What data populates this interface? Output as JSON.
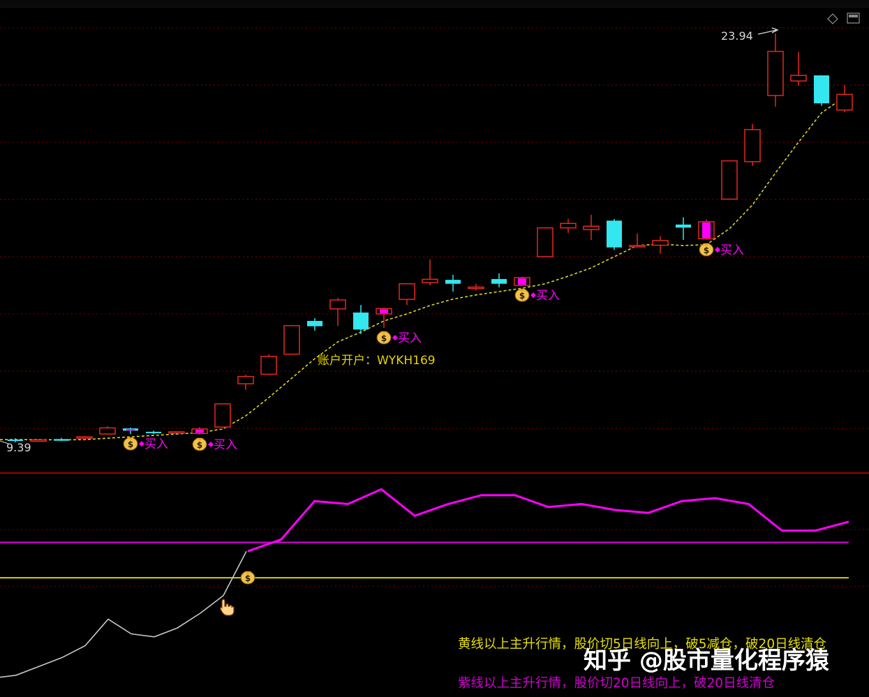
{
  "colors": {
    "up": "#e8271f",
    "down": "#33e6f0",
    "magenta": "#ff00ff",
    "ma_yellow": "#d9d42a",
    "yellow_text": "#e6e000",
    "grid": "#8a0000",
    "white_line": "#c8c8c8"
  },
  "icons": {
    "buy_marker": "money-bag-icon",
    "cursor": "hand-pointer-icon",
    "diamond": "diamond-icon",
    "window": "window-icon"
  },
  "price_panel": {
    "high_label": "23.94",
    "low_label": "9.39",
    "account_text": "账户开户：WYKH169"
  },
  "buy_label": "买入",
  "indicator_panel": {
    "legend_yellow": "黄线以上主升行情，股价切5日线向上，破5减仓，破20日线清仓",
    "legend_purple": "紫线以上主升行情，股价切20日线向上，破20日线清仓"
  },
  "watermark": "知乎 @股市量化程序猿",
  "chart_data": [
    {
      "type": "candlestick",
      "title": "",
      "ylim": [
        9.0,
        25.0
      ],
      "candles": [
        {
          "o": 9.4,
          "h": 9.45,
          "l": 9.3,
          "c": 9.35
        },
        {
          "o": 9.38,
          "h": 9.42,
          "l": 9.33,
          "c": 9.39
        },
        {
          "o": 9.42,
          "h": 9.46,
          "l": 9.35,
          "c": 9.36
        },
        {
          "o": 9.45,
          "h": 9.52,
          "l": 9.4,
          "c": 9.5
        },
        {
          "o": 9.6,
          "h": 9.88,
          "l": 9.58,
          "c": 9.82
        },
        {
          "o": 9.8,
          "h": 9.83,
          "l": 9.6,
          "c": 9.72
        },
        {
          "o": 9.68,
          "h": 9.72,
          "l": 9.6,
          "c": 9.66
        },
        {
          "o": 9.66,
          "h": 9.7,
          "l": 9.64,
          "c": 9.68
        },
        {
          "o": 9.62,
          "h": 9.85,
          "l": 9.58,
          "c": 9.78
        },
        {
          "o": 9.85,
          "h": 10.7,
          "l": 9.84,
          "c": 10.68
        },
        {
          "o": 11.4,
          "h": 11.72,
          "l": 11.18,
          "c": 11.66
        },
        {
          "o": 11.74,
          "h": 12.45,
          "l": 11.72,
          "c": 12.38
        },
        {
          "o": 12.46,
          "h": 13.5,
          "l": 12.44,
          "c": 13.48
        },
        {
          "o": 13.65,
          "h": 13.75,
          "l": 13.3,
          "c": 13.46
        },
        {
          "o": 14.08,
          "h": 14.48,
          "l": 13.47,
          "c": 14.4
        },
        {
          "o": 13.95,
          "h": 14.22,
          "l": 13.18,
          "c": 13.34
        },
        {
          "o": 13.9,
          "h": 14.12,
          "l": 13.4,
          "c": 14.09
        },
        {
          "o": 14.42,
          "h": 14.98,
          "l": 14.22,
          "c": 14.98
        },
        {
          "o": 15.02,
          "h": 15.85,
          "l": 14.92,
          "c": 15.14
        },
        {
          "o": 15.12,
          "h": 15.3,
          "l": 14.7,
          "c": 14.98
        },
        {
          "o": 14.82,
          "h": 14.98,
          "l": 14.74,
          "c": 14.86
        },
        {
          "o": 15.15,
          "h": 15.35,
          "l": 14.85,
          "c": 14.98
        },
        {
          "o": 14.92,
          "h": 15.24,
          "l": 14.92,
          "c": 15.2
        },
        {
          "o": 15.95,
          "h": 16.98,
          "l": 15.95,
          "c": 16.98
        },
        {
          "o": 16.98,
          "h": 17.3,
          "l": 16.8,
          "c": 17.14
        },
        {
          "o": 16.92,
          "h": 17.45,
          "l": 16.55,
          "c": 17.04
        },
        {
          "o": 17.24,
          "h": 17.3,
          "l": 16.19,
          "c": 16.28
        },
        {
          "o": 16.35,
          "h": 16.78,
          "l": 16.3,
          "c": 16.35
        },
        {
          "o": 16.36,
          "h": 16.68,
          "l": 16.06,
          "c": 16.53
        },
        {
          "o": 17.1,
          "h": 17.36,
          "l": 16.55,
          "c": 16.99
        },
        {
          "o": 16.59,
          "h": 17.28,
          "l": 16.55,
          "c": 17.2
        },
        {
          "o": 18.01,
          "h": 19.38,
          "l": 18.01,
          "c": 19.38
        },
        {
          "o": 19.35,
          "h": 20.7,
          "l": 19.2,
          "c": 20.5
        },
        {
          "o": 21.72,
          "h": 23.94,
          "l": 21.32,
          "c": 23.3
        },
        {
          "o": 22.24,
          "h": 23.28,
          "l": 22.07,
          "c": 22.44
        },
        {
          "o": 22.44,
          "h": 22.44,
          "l": 21.35,
          "c": 21.44
        },
        {
          "o": 21.2,
          "h": 22.1,
          "l": 21.12,
          "c": 21.76
        }
      ],
      "ma_line": [
        9.4,
        9.4,
        9.39,
        9.4,
        9.45,
        9.5,
        9.55,
        9.6,
        9.65,
        9.78,
        10.25,
        10.9,
        11.6,
        12.3,
        12.9,
        13.25,
        13.65,
        13.9,
        14.2,
        14.43,
        14.58,
        14.7,
        14.82,
        14.98,
        15.25,
        15.55,
        15.95,
        16.35,
        16.4,
        16.35,
        16.38,
        16.95,
        17.8,
        18.95,
        20.05,
        21.1,
        21.67
      ],
      "buy_signals": [
        5,
        8,
        16,
        22,
        30
      ]
    },
    {
      "type": "line",
      "title": "",
      "ylim": [
        0,
        100
      ],
      "thresholds": {
        "purple": 56,
        "yellow": 44
      },
      "white_series": [
        10,
        11,
        14,
        17,
        21,
        30,
        25,
        24,
        27,
        32,
        38,
        53
      ],
      "magenta_series": [
        53,
        57,
        70,
        69,
        74,
        65,
        69,
        72,
        72,
        68,
        69,
        67,
        66,
        70,
        71,
        69,
        60,
        60,
        63
      ],
      "buy_signal_at": 10
    }
  ]
}
